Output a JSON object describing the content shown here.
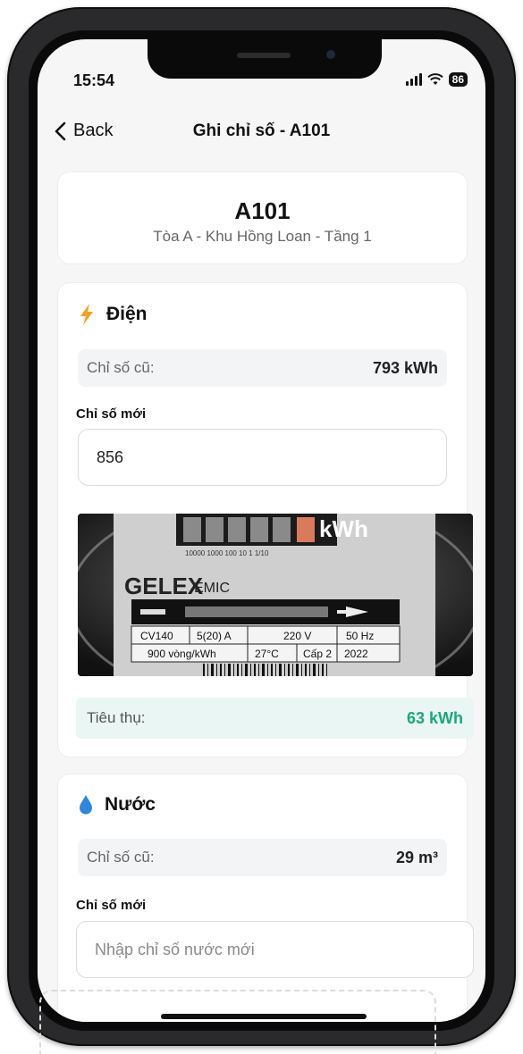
{
  "status": {
    "time": "15:54",
    "battery": "86"
  },
  "nav": {
    "back_label": "Back",
    "title": "Ghi chỉ số - A101"
  },
  "room": {
    "code": "A101",
    "location": "Tòa A - Khu Hồng Loan - Tầng 1"
  },
  "electric": {
    "title": "Điện",
    "old_label": "Chỉ số cũ:",
    "old_value": "793 kWh",
    "new_label": "Chỉ số mới",
    "new_value": "856",
    "consumption_label": "Tiêu thụ:",
    "consumption_value": "63 kWh",
    "consumption_color": "#1aa97a",
    "icon": "lightning-icon",
    "icon_color": "#f6a11a",
    "meter": {
      "unit": "kWh",
      "brand": "GELEX",
      "brand_sub": "EMIC",
      "model": "CV140",
      "current": "5(20) A",
      "voltage": "220 V",
      "freq": "50 Hz",
      "rate": "900 vòng/kWh",
      "temp": "27°C",
      "grade": "Cấp 2",
      "year": "2022",
      "dial_scale": [
        "10000",
        "1000",
        "100",
        "10",
        "1",
        "1/10"
      ]
    }
  },
  "water": {
    "title": "Nước",
    "old_label": "Chỉ số cũ:",
    "old_value": "29 m³",
    "new_label": "Chỉ số mới",
    "new_placeholder": "Nhập chỉ số nước mới",
    "icon": "water-drop-icon",
    "icon_color": "#2f86e0"
  }
}
